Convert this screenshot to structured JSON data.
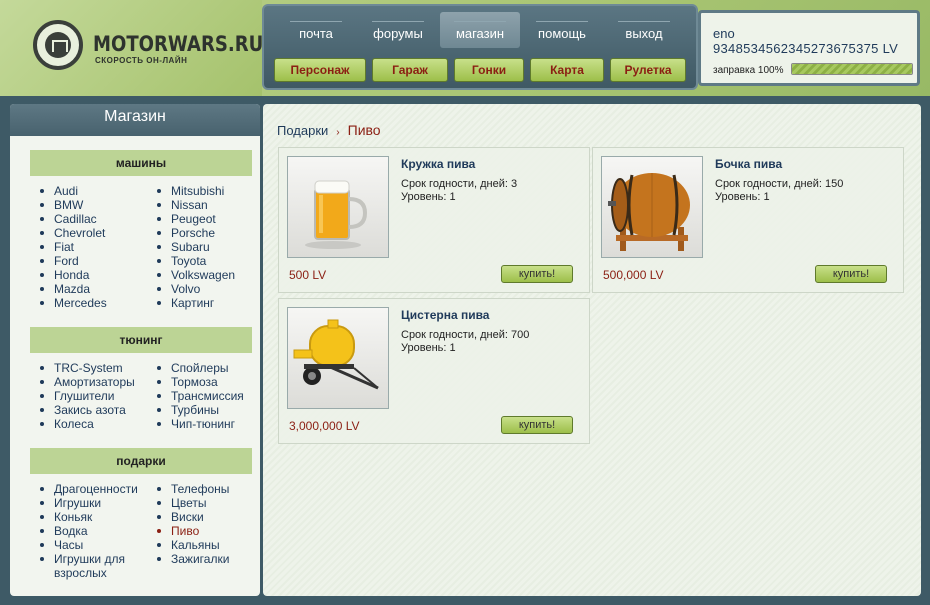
{
  "brand": {
    "name": "MOTORWARS.RU",
    "tagline": "СКОРОСТЬ ОН-ЛАЙН"
  },
  "top_nav": [
    "почта",
    "форумы",
    "магазин",
    "помощь",
    "выход"
  ],
  "sub_nav": [
    "Персонаж",
    "Гараж",
    "Гонки",
    "Карта",
    "Рулетка"
  ],
  "user": {
    "name": "eno",
    "money": "934853456234527367537​5 LV",
    "fuel_label": "заправка 100%",
    "fuel_percent": 100
  },
  "sidebar": {
    "title": "Магазин",
    "sections": [
      {
        "heading": "машины",
        "col1": [
          "Audi",
          "BMW",
          "Cadillac",
          "Chevrolet",
          "Fiat",
          "Ford",
          "Honda",
          "Mazda",
          "Mercedes"
        ],
        "col2": [
          "Mitsubishi",
          "Nissan",
          "Peugeot",
          "Porsche",
          "Subaru",
          "Toyota",
          "Volkswagen",
          "Volvo",
          "Картинг"
        ]
      },
      {
        "heading": "тюнинг",
        "col1": [
          "TRC-System",
          "Амортизаторы",
          "Глушители",
          "Закись азота",
          "Колеса"
        ],
        "col2": [
          "Спойлеры",
          "Тормоза",
          "Трансмиссия",
          "Турбины",
          "Чип-тюнинг"
        ]
      },
      {
        "heading": "подарки",
        "col1": [
          "Драгоценности",
          "Игрушки",
          "Коньяк",
          "Водка",
          "Часы",
          "Игрушки для взрослых"
        ],
        "col2": [
          "Телефоны",
          "Цветы",
          "Виски",
          "Пиво",
          "Кальяны",
          "Зажигалки"
        ]
      }
    ]
  },
  "breadcrumb": {
    "parent": "Подарки",
    "separator": "›",
    "current": "Пиво"
  },
  "detail_labels": {
    "shelf_life": "Срок годности, дней:",
    "level": "Уровень:"
  },
  "products": [
    {
      "name": "Кружка пива",
      "shelf_life": "3",
      "level": "1",
      "price": "500 LV",
      "buy": "купить!",
      "icon": "beer-mug-icon"
    },
    {
      "name": "Бочка пива",
      "shelf_life": "150",
      "level": "1",
      "price": "500,000 LV",
      "buy": "купить!",
      "icon": "beer-barrel-icon"
    },
    {
      "name": "Цистерна пива",
      "shelf_life": "700",
      "level": "1",
      "price": "3,000,000 LV",
      "buy": "купить!",
      "icon": "beer-tank-trailer-icon"
    }
  ],
  "colors": {
    "accent_red": "#8b1f13",
    "link_blue": "#1f3a5a",
    "green_button": "#b3d06a",
    "category_bg": "#bcd495"
  }
}
